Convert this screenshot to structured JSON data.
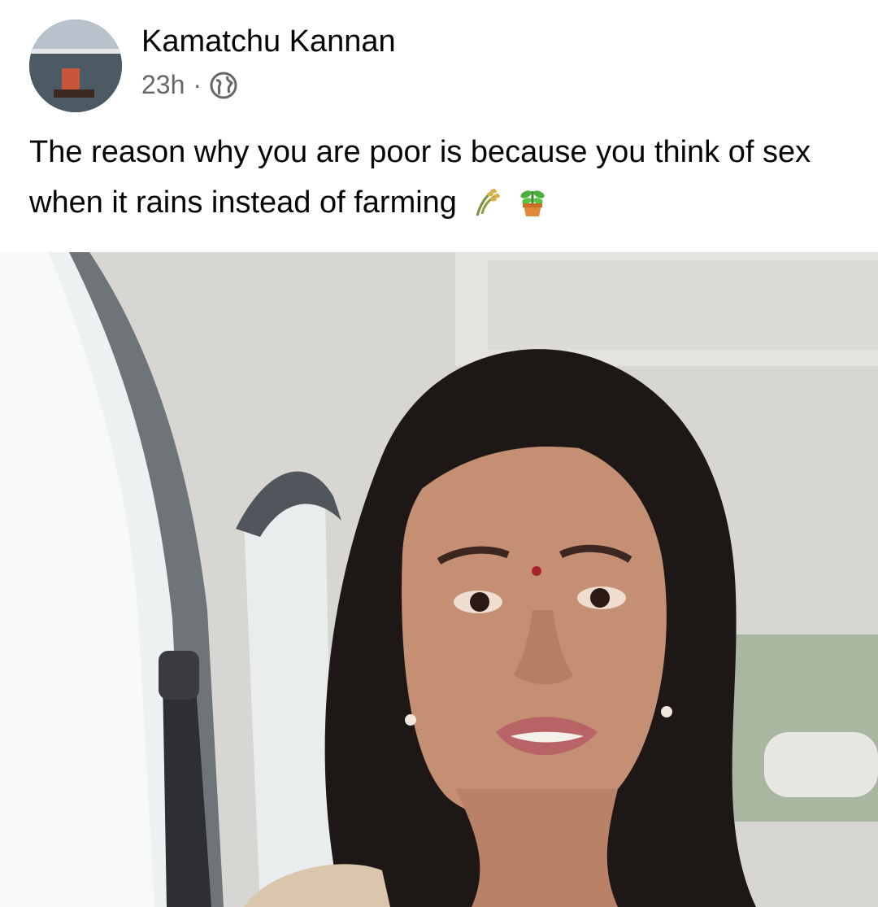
{
  "post": {
    "author_name": "Kamatchu Kannan",
    "timestamp": "23h",
    "separator": "·",
    "privacy_icon": "globe-icon",
    "caption_text": "The reason why you are poor is because you think of sex when it rains instead of farming",
    "caption_emojis": [
      "rice-sheaf-icon",
      "potted-plant-icon"
    ],
    "avatar_icon": "profile-picture",
    "photo_icon": "selfie-in-car-photo"
  },
  "colors": {
    "text_primary": "#050505",
    "text_secondary": "#65676b",
    "background": "#ffffff"
  }
}
